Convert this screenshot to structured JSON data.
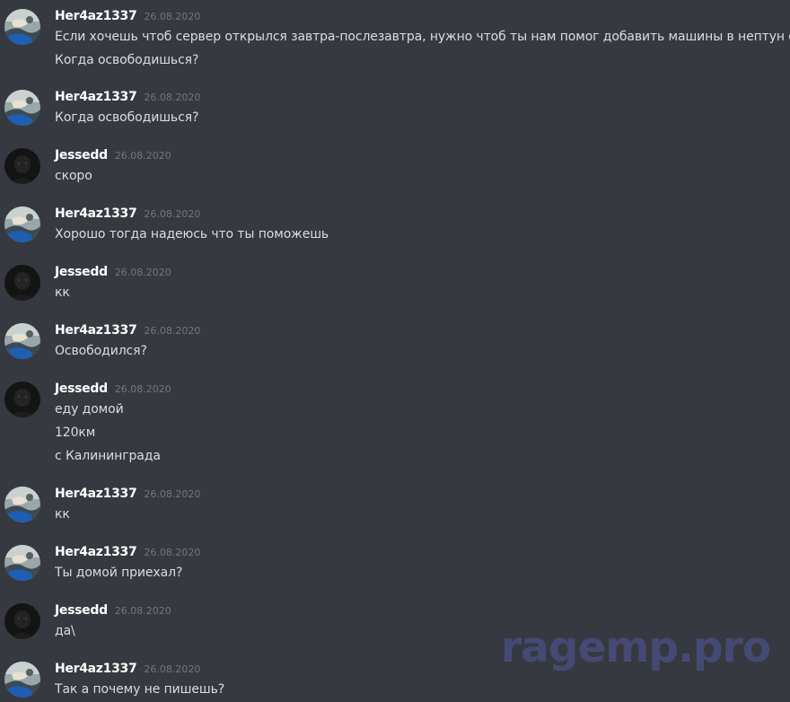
{
  "users": {
    "her": {
      "name": "Her4az1337",
      "avatar_icon": "photo-avatar-icon"
    },
    "jes": {
      "name": "Jessedd",
      "avatar_icon": "dark-avatar-icon"
    }
  },
  "messages": [
    {
      "author": "Her4az1337",
      "timestamp": "26.08.2020",
      "lines": [
        "Если хочешь чтоб сервер открылся завтра-послезавтра, нужно чтоб ты нам помог добавить машины в нептун его",
        "Когда освободишься?"
      ]
    },
    {
      "author": "Her4az1337",
      "timestamp": "26.08.2020",
      "lines": [
        "Когда освободишься?"
      ]
    },
    {
      "author": "Jessedd",
      "timestamp": "26.08.2020",
      "lines": [
        "скоро"
      ]
    },
    {
      "author": "Her4az1337",
      "timestamp": "26.08.2020",
      "lines": [
        "Хорошо тогда надеюсь что ты поможешь"
      ]
    },
    {
      "author": "Jessedd",
      "timestamp": "26.08.2020",
      "lines": [
        "кк"
      ]
    },
    {
      "author": "Her4az1337",
      "timestamp": "26.08.2020",
      "lines": [
        "Освободился?"
      ]
    },
    {
      "author": "Jessedd",
      "timestamp": "26.08.2020",
      "lines": [
        "еду домой",
        "120км",
        "с Калининграда"
      ]
    },
    {
      "author": "Her4az1337",
      "timestamp": "26.08.2020",
      "lines": [
        "кк"
      ]
    },
    {
      "author": "Her4az1337",
      "timestamp": "26.08.2020",
      "lines": [
        "Ты домой приехал?"
      ]
    },
    {
      "author": "Jessedd",
      "timestamp": "26.08.2020",
      "lines": [
        "да\\"
      ]
    },
    {
      "author": "Her4az1337",
      "timestamp": "26.08.2020",
      "lines": [
        "Так а почему не пишешь?"
      ]
    }
  ],
  "watermark": "ragemp.pro",
  "colors": {
    "background": "#36393f",
    "username": "#ffffff",
    "timestamp": "#72767d",
    "text": "#dcddde",
    "watermark": "#4a4f84"
  }
}
